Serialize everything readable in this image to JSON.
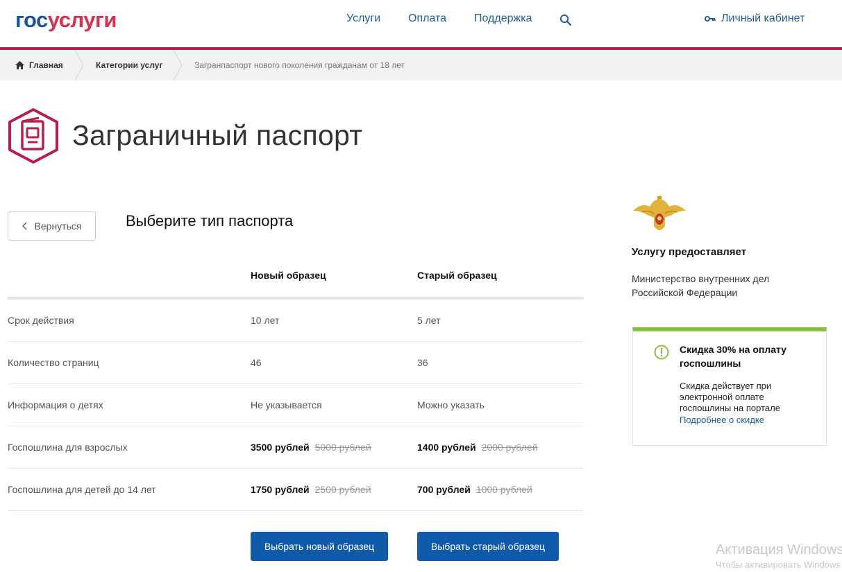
{
  "header": {
    "logo_part1": "гос",
    "logo_part2": "услуги",
    "nav": [
      "Услуги",
      "Оплата",
      "Поддержка"
    ],
    "cabinet_label": "Личный кабинет",
    "logo_colors": {
      "gos": "#1a5599",
      "uslugi": "#d9304f"
    },
    "accent_line_color": "#b5214a"
  },
  "breadcrumbs": {
    "home": "Главная",
    "category": "Категории услуг",
    "current": "Загранпаспорт нового поколения гражданам от 18 лет"
  },
  "page": {
    "title": "Заграничный паспорт",
    "back_label": "Вернуться",
    "subtitle": "Выберите тип паспорта"
  },
  "table": {
    "columns": [
      "Новый образец",
      "Старый образец"
    ],
    "rows": [
      {
        "label": "Срок действия",
        "new": "10 лет",
        "old": "5 лет"
      },
      {
        "label": "Количество страниц",
        "new": "46",
        "old": "36"
      },
      {
        "label": "Информация о детях",
        "new": "Не указывается",
        "old": "Можно указать"
      },
      {
        "label": "Госпошлина для взрослых",
        "new_price": "3500 рублей",
        "new_old_price": "5000 рублей",
        "old_price": "1400 рублей",
        "old_old_price": "2000 рублей"
      },
      {
        "label": "Госпошлина для детей до 14 лет",
        "new_price": "1750 рублей",
        "new_old_price": "2500 рублей",
        "old_price": "700 рублей",
        "old_old_price": "1000 рублей"
      }
    ]
  },
  "buttons": {
    "choose_new": "Выбрать новый образец",
    "choose_old": "Выбрать старый образец",
    "color": "#0f5aa9"
  },
  "sidebar": {
    "provider_title": "Услугу предоставляет",
    "provider_name": "Министерство внутренних дел Российской Федерации",
    "discount": {
      "title": "Скидка 30% на оплату госпошлины",
      "text": "Скидка действует при электронной оплате госпошлины на портале",
      "link": "Подробнее о скидке",
      "accent_color": "#8cbf3f"
    }
  },
  "watermark": {
    "line1": "Активация Windows",
    "line2": "Чтобы активировать Windows"
  }
}
